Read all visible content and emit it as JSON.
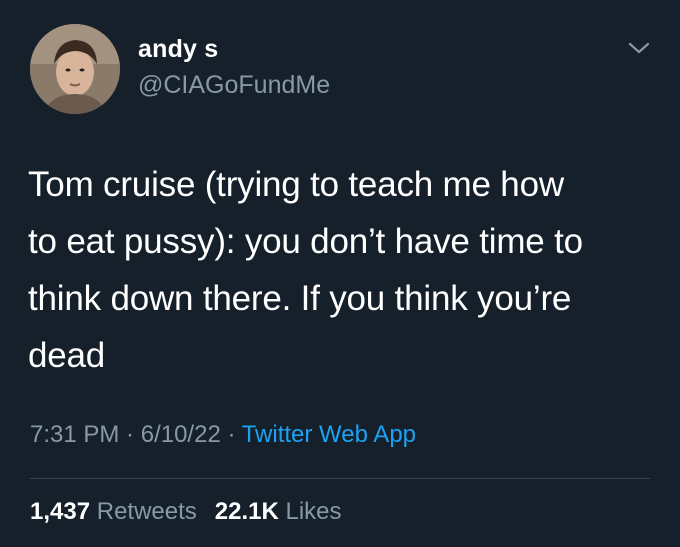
{
  "author": {
    "display_name": "andy s",
    "handle": "@CIAGoFundMe"
  },
  "tweet": {
    "text": "Tom cruise (trying to teach me how\nto eat pussy): you don’t have time to\nthink down there. If you think you’re\ndead",
    "time": "7:31 PM",
    "date": "6/10/22",
    "source": "Twitter Web App",
    "separator": " · "
  },
  "stats": {
    "retweets_count": "1,437",
    "retweets_label": " Retweets",
    "likes_count": "22.1K",
    "likes_label": " Likes"
  },
  "icons": {
    "menu": "chevron-down-icon"
  },
  "colors": {
    "background": "#15202b",
    "text": "#ffffff",
    "muted": "#8899a6",
    "link": "#1da1f2"
  }
}
